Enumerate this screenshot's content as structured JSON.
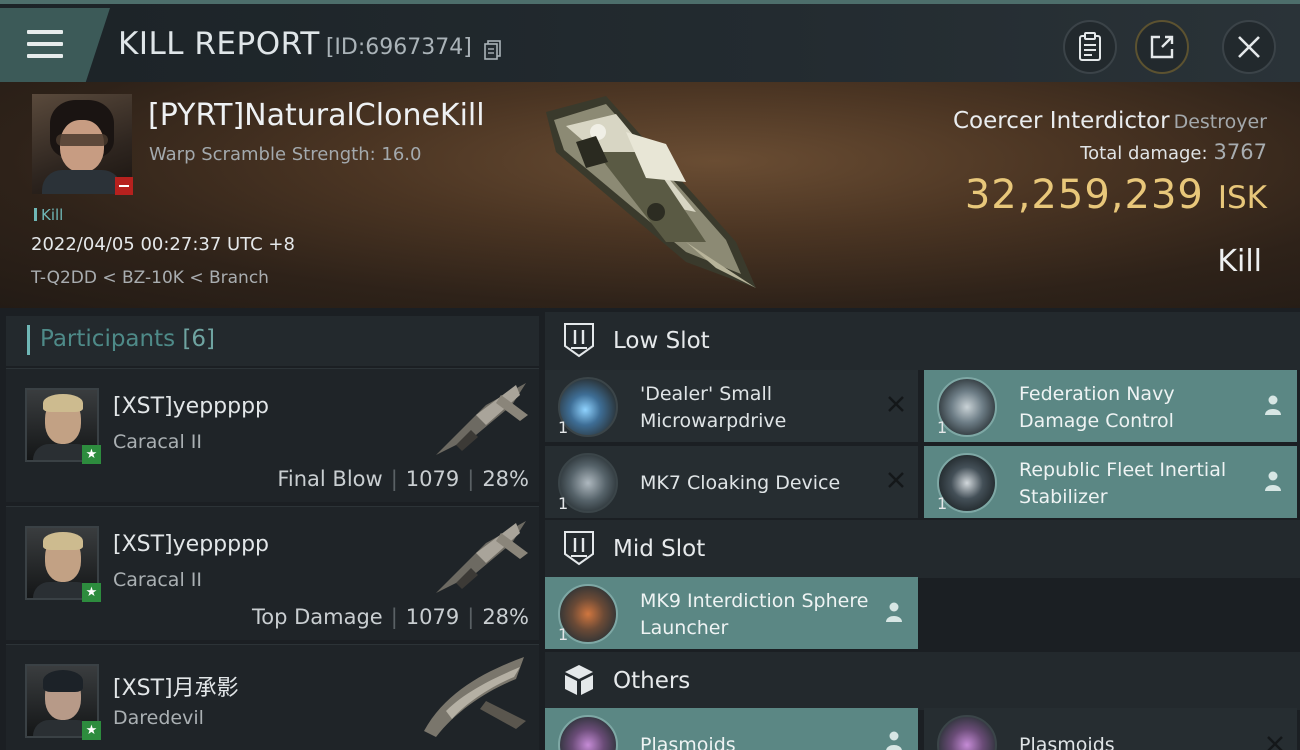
{
  "header": {
    "title": "KILL REPORT",
    "report_id": "[ID:6967374]"
  },
  "victim": {
    "name": "[PYRT]NaturalCloneKill",
    "warp_scramble": "Warp Scramble Strength: 16.0",
    "tag": "Kill",
    "datetime": "2022/04/05 00:27:37 UTC +8",
    "location": "T-Q2DD < BZ-10K < Branch",
    "ship_name": "Coercer Interdictor",
    "ship_class": "Destroyer",
    "total_damage_label": "Total damage:",
    "total_damage": "3767",
    "isk_value": "32,259,239",
    "isk_unit": "ISK",
    "result": "Kill"
  },
  "participants": {
    "label": "Participants",
    "count": "[6]",
    "list": [
      {
        "name": "[XST]yeppppp",
        "ship": "Caracal II",
        "role": "Final Blow",
        "damage": "1079",
        "percent": "28%"
      },
      {
        "name": "[XST]yeppppp",
        "ship": "Caracal II",
        "role": "Top Damage",
        "damage": "1079",
        "percent": "28%"
      },
      {
        "name": "[XST]月承影",
        "ship": "Daredevil"
      }
    ]
  },
  "slots": {
    "low": {
      "label": "Low Slot",
      "items": [
        {
          "qty": "1",
          "name": "'Dealer' Small Microwarpdrive",
          "status": "destroyed"
        },
        {
          "qty": "1",
          "name": "Federation Navy Damage Control",
          "status": "dropped"
        },
        {
          "qty": "1",
          "name": "MK7 Cloaking Device",
          "status": "destroyed"
        },
        {
          "qty": "1",
          "name": "Republic Fleet Inertial Stabilizer",
          "status": "dropped"
        }
      ]
    },
    "mid": {
      "label": "Mid Slot",
      "items": [
        {
          "qty": "1",
          "name": "MK9 Interdiction Sphere Launcher",
          "status": "dropped"
        }
      ]
    },
    "others": {
      "label": "Others",
      "items": [
        {
          "qty": "",
          "name": "Plasmoids",
          "status": "dropped"
        },
        {
          "qty": "",
          "name": "Plasmoids",
          "status": "destroyed"
        }
      ]
    }
  },
  "icons": {
    "menu": "hamburger-menu-icon",
    "copy": "copy-icon",
    "clipboard": "clipboard-icon",
    "share": "share-icon",
    "close": "close-icon",
    "destroyed": "x-mark-icon",
    "dropped": "person-icon"
  },
  "colors": {
    "accent_teal": "#6fb7b6",
    "isk_gold": "#e8c77a",
    "highlight_row": "#5b8784",
    "loss_badge": "#b6211e",
    "ally_badge": "#2d8c3e"
  }
}
